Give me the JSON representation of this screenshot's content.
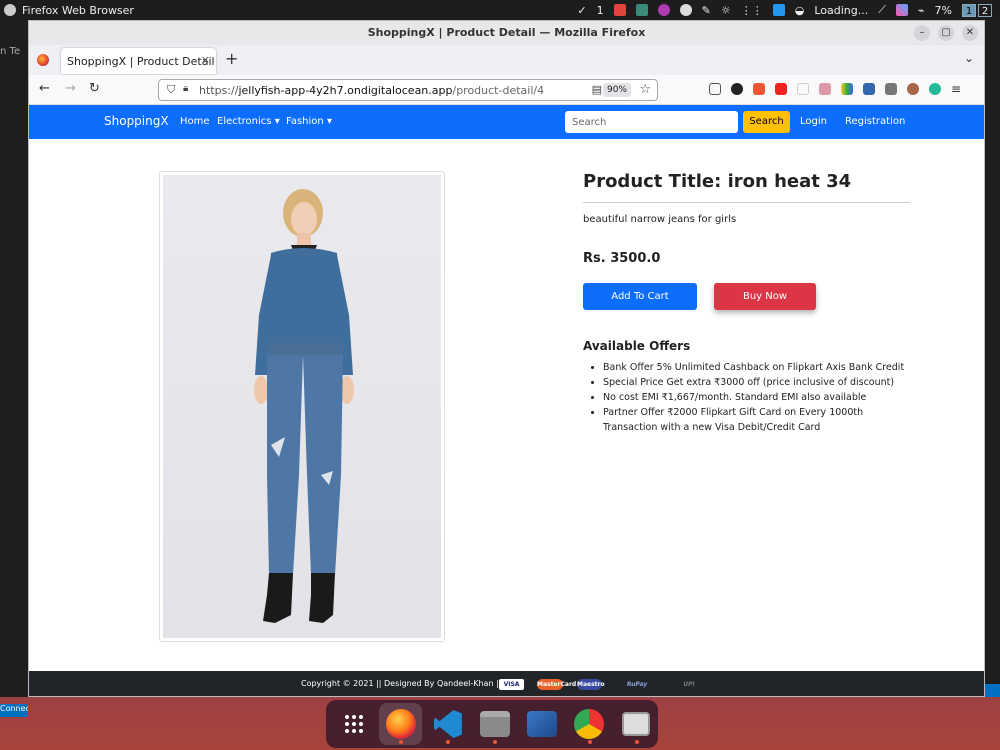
{
  "system_bar": {
    "app_name": "Firefox Web Browser",
    "notify_count": "1",
    "loading_text": "Loading...",
    "battery": "7%",
    "workspaces": [
      "1",
      "2"
    ]
  },
  "left_strip": {
    "menu_items": [
      "n",
      "Te"
    ],
    "status_text": "Connect"
  },
  "window": {
    "title": "ShoppingX | Product Detail — Mozilla Firefox"
  },
  "tab": {
    "title": "ShoppingX | Product Detail",
    "close": "×",
    "new": "+"
  },
  "url": {
    "prefix": "https://",
    "host": "jellyfish-app-4y2h7.ondigitalocean.app",
    "path": "/product-detail/4",
    "zoom": "90%"
  },
  "navbar": {
    "brand": "ShoppingX",
    "home": "Home",
    "electronics": "Electronics",
    "fashion": "Fashion",
    "search_placeholder": "Search",
    "search_button": "Search",
    "login": "Login",
    "registration": "Registration"
  },
  "product": {
    "title": "Product Title: iron heat 34",
    "description": "beautiful narrow jeans for girls",
    "price": "Rs. 3500.0",
    "add_to_cart": "Add To Cart",
    "buy_now": "Buy Now",
    "offers_heading": "Available Offers",
    "offers": [
      "Bank Offer 5% Unlimited Cashback on Flipkart Axis Bank Credit",
      "Special Price Get extra ₹3000 off (price inclusive of discount)",
      "No cost EMI ₹1,667/month. Standard EMI also available",
      "Partner Offer ₹2000 Flipkart Gift Card on Every 1000th Transaction with a new Visa Debit/Credit Card"
    ]
  },
  "footer": {
    "copyright": "Copyright © 2021 || Designed By Qandeel-Khan ||",
    "payment": [
      "VISA",
      "MasterCard",
      "Maestro",
      "RuPay",
      "UPI"
    ]
  },
  "colors": {
    "primary": "#0d6efd",
    "warning": "#ffc107",
    "danger": "#dc3545",
    "footer": "#212529"
  }
}
